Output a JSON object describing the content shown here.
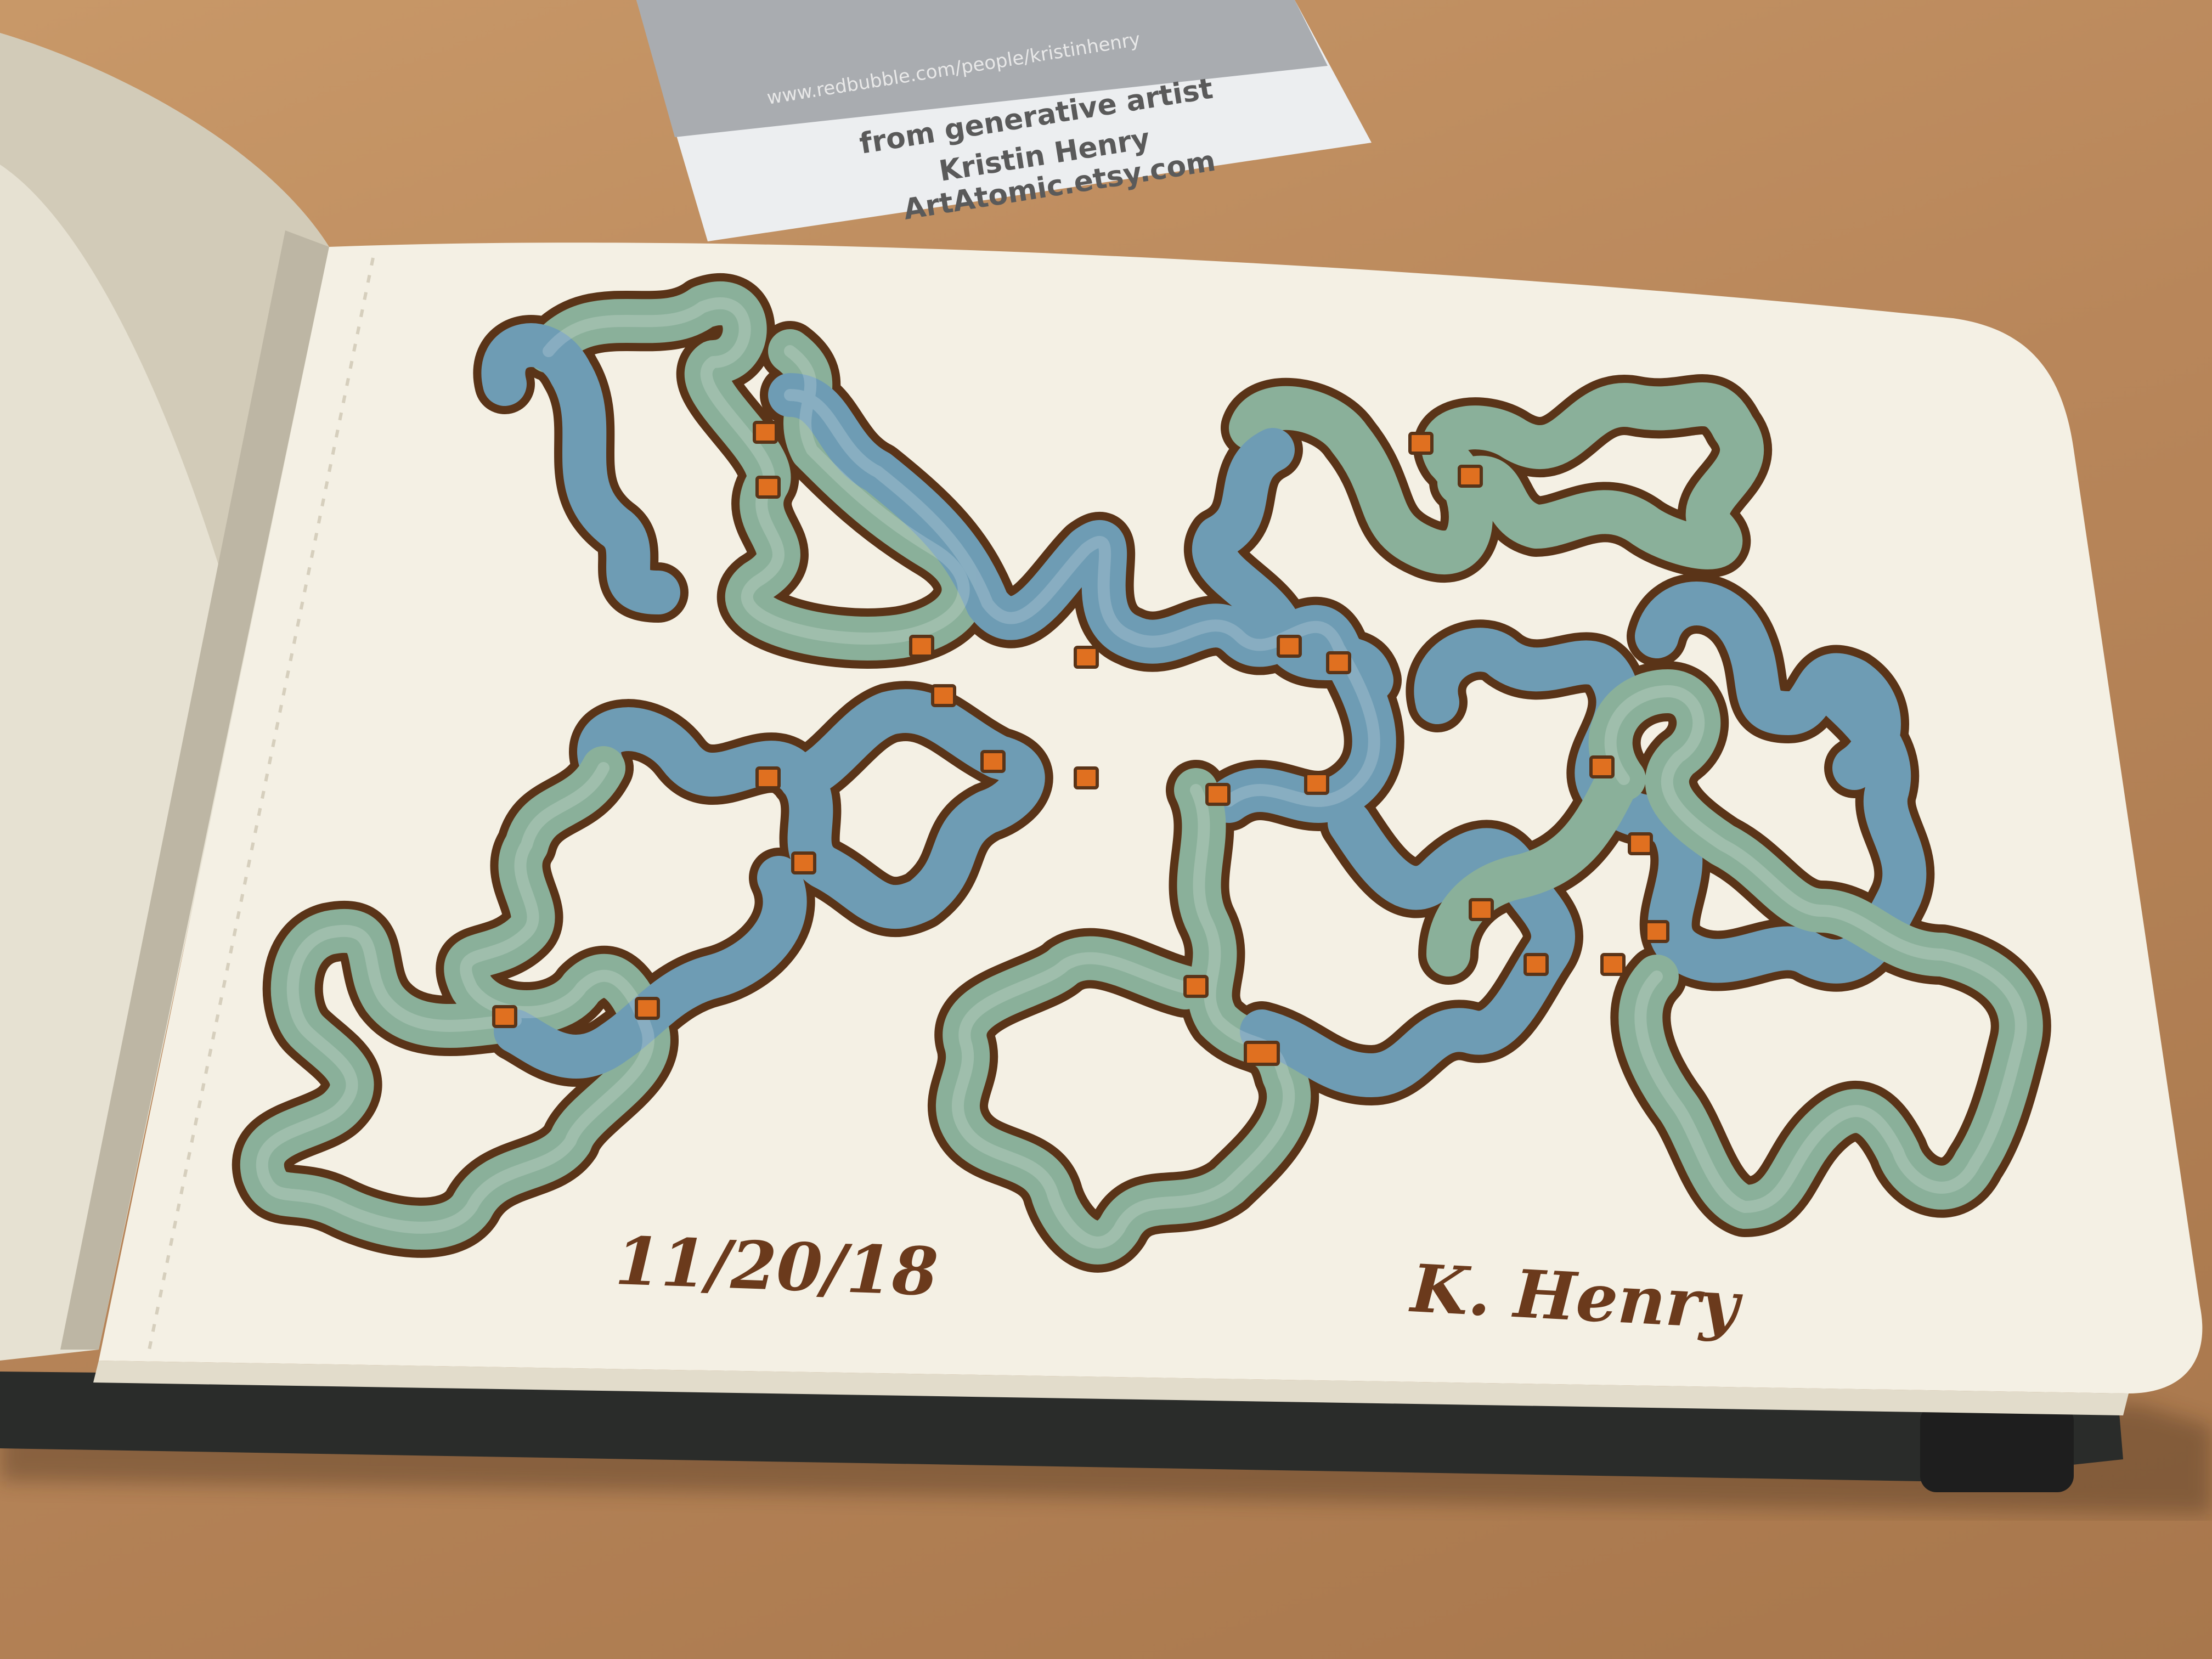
{
  "card": {
    "url_line": "www.redbubble.com/people/kristinhenry",
    "line1": "from generative artist",
    "line2": "Kristin Henry",
    "line3": "ArtAtomic.etsy.com"
  },
  "sketch": {
    "date": "11/20/18",
    "signature": "K. Henry"
  },
  "colors": {
    "table": "#b8865a",
    "paper": "#f4f0e4",
    "ink_outline": "#5a3418",
    "loop_blue": "#6e9cb4",
    "loop_green": "#8ab09a",
    "crossing_orange": "#e07020"
  }
}
